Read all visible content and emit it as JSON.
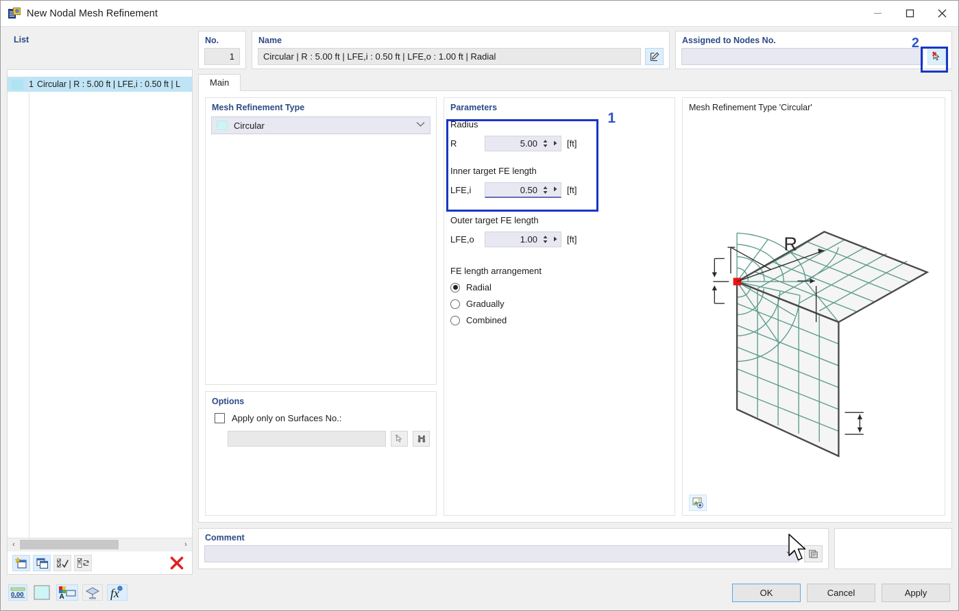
{
  "window": {
    "title": "New Nodal Mesh Refinement",
    "icon": "mesh-refinement-icon",
    "minimize": "–",
    "maximize": "□",
    "close": "✕"
  },
  "list_panel": {
    "legend": "List",
    "rows": [
      {
        "number": "1",
        "text": "Circular | R : 5.00 ft | LFE,i : 0.50 ft | L",
        "selected": true
      }
    ],
    "scroll_left": "‹",
    "scroll_right": "›",
    "toolbar": [
      {
        "name": "new-item-button",
        "icon": "new-window-icon"
      },
      {
        "name": "copy-item-button",
        "icon": "copy-window-icon"
      },
      {
        "name": "select-all-button",
        "icon": "check-list-icon"
      },
      {
        "name": "invert-selection-button",
        "icon": "toggle-check-icon"
      },
      {
        "name": "delete-item-button",
        "icon": "red-x-icon"
      }
    ]
  },
  "no_panel": {
    "legend": "No.",
    "value": "1"
  },
  "name_panel": {
    "legend": "Name",
    "value": "Circular | R : 5.00 ft | LFE,i : 0.50 ft | LFE,o : 1.00 ft | Radial",
    "edit_button_icon": "edit-name-icon"
  },
  "assigned_panel": {
    "legend": "Assigned to Nodes No.",
    "value": "",
    "marker": "2",
    "clear_button_icon": "deselect-cursor-icon"
  },
  "tabs": [
    {
      "label": "Main",
      "active": true
    }
  ],
  "mesh_refinement_type": {
    "legend": "Mesh Refinement Type",
    "selected": "Circular",
    "options": [
      "Circular"
    ],
    "chevron": "⌄"
  },
  "parameters": {
    "legend": "Parameters",
    "marker": "1",
    "radius": {
      "label": "Radius",
      "symbol": "R",
      "value": "5.00",
      "unit": "[ft]"
    },
    "inner_fe": {
      "label": "Inner target FE length",
      "symbol": "LFE,i",
      "value": "0.50",
      "unit": "[ft]"
    },
    "outer_fe": {
      "label": "Outer target FE length",
      "symbol": "LFE,o",
      "value": "1.00",
      "unit": "[ft]"
    },
    "arrangement": {
      "label": "FE length arrangement",
      "options": [
        {
          "label": "Radial",
          "selected": true
        },
        {
          "label": "Gradually",
          "selected": false
        },
        {
          "label": "Combined",
          "selected": false
        }
      ]
    }
  },
  "options": {
    "legend": "Options",
    "checkbox_label": "Apply only on Surfaces No.:",
    "checked": false,
    "value": "",
    "pick_button_icon": "select-cursor-icon",
    "find_button_icon": "binoculars-icon"
  },
  "comment": {
    "legend": "Comment",
    "value": "",
    "chevron": "⌄",
    "copy_button_icon": "clipboard-icon"
  },
  "preview": {
    "title": "Mesh Refinement Type 'Circular'",
    "radius_label": "R",
    "image_button_icon": "image-export-icon",
    "colors": {
      "mesh": "#5d9b8c",
      "outline": "#4a4a4a",
      "node": "#ee1111",
      "face": "#f4f5f4"
    }
  },
  "footer": {
    "left_tools": [
      {
        "name": "decimal-places-button",
        "icon": "0,00"
      },
      {
        "name": "color-swatch-button",
        "icon": "color-box-icon"
      },
      {
        "name": "text-style-button",
        "icon": "palette-text-icon"
      },
      {
        "name": "visibility-button",
        "icon": "render-icon"
      },
      {
        "name": "formula-button",
        "icon": "fx-icon"
      }
    ],
    "ok_label": "OK",
    "cancel_label": "Cancel",
    "apply_label": "Apply"
  },
  "colors": {
    "accent_blue": "#2c4a86",
    "highlight_blue": "#1636c6",
    "marker_blue": "#2f54c9",
    "field_lavender": "#e8e8f2",
    "selection_cyan": "#bfe4f5"
  }
}
